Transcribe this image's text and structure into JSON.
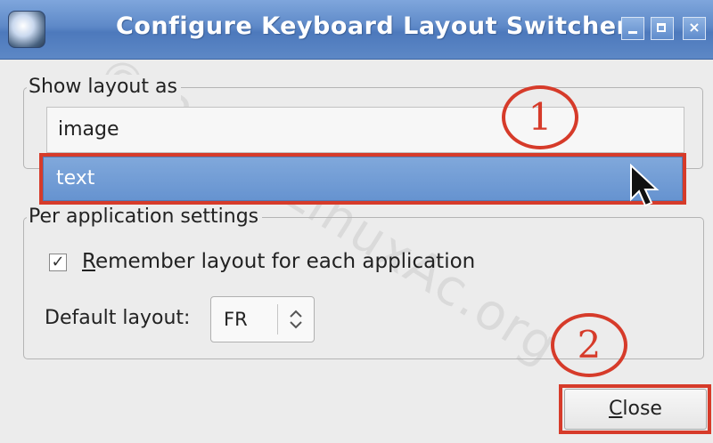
{
  "window": {
    "title": "Configure Keyboard Layout Switcher",
    "minimize_glyph": "_",
    "maximize_glyph": "□",
    "close_glyph": "×"
  },
  "show_layout": {
    "legend": "Show layout as",
    "options": [
      "image",
      "text"
    ],
    "selected": "text"
  },
  "per_app": {
    "legend": "Per application settings",
    "checkbox_checked": true,
    "checkbox_glyph": "✓",
    "checkbox_label_first": "R",
    "checkbox_label_rest": "emember layout for each application",
    "default_layout_label": "Default layout:",
    "default_layout_value": "FR"
  },
  "close_button": {
    "first": "C",
    "rest": "lose"
  },
  "annotations": {
    "one": "1",
    "two": "2",
    "color": "#d63b2a"
  },
  "watermark": "© 2018 LinuxAc.org",
  "colors": {
    "titlebar": "#5e89c8",
    "selection": "#6f9ad4"
  }
}
